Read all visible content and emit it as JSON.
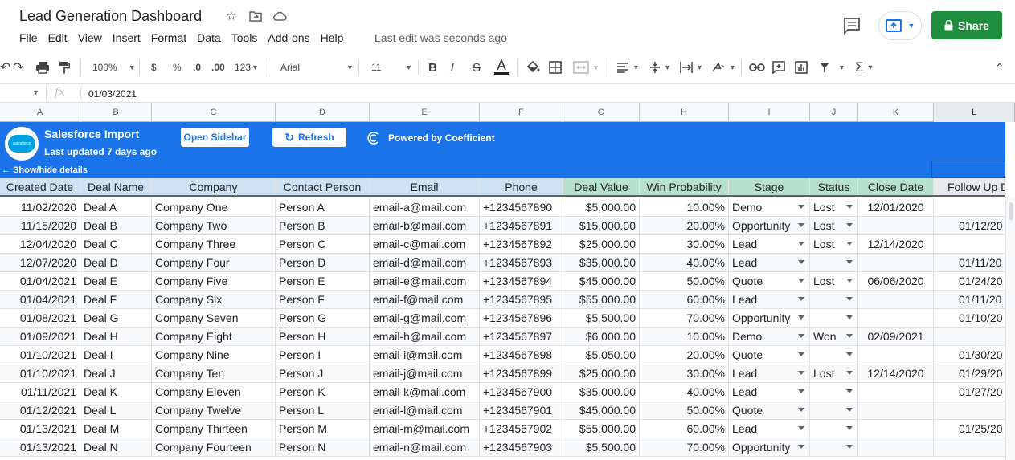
{
  "app": {
    "title": "Lead Generation Dashboard",
    "menu": [
      "File",
      "Edit",
      "View",
      "Insert",
      "Format",
      "Data",
      "Tools",
      "Add-ons",
      "Help"
    ],
    "last_edit": "Last edit was seconds ago",
    "share_label": "Share",
    "accent_green": "#1e8e3e"
  },
  "toolbar": {
    "zoom": "100%",
    "currency": "$",
    "percent": "%",
    "dec_less": ".0",
    "dec_more": ".00",
    "format_more": "123",
    "font": "Arial",
    "font_size": "11"
  },
  "formula_bar": {
    "fx": "fx",
    "value": "01/03/2021"
  },
  "column_letters": [
    "A",
    "B",
    "C",
    "D",
    "E",
    "F",
    "G",
    "H",
    "I",
    "J",
    "K",
    "L"
  ],
  "banner": {
    "title": "Salesforce Import",
    "updated": "Last updated 7 days ago",
    "open_sidebar": "Open Sidebar",
    "refresh": "Refresh",
    "powered": "Powered by Coefficient",
    "toggle": "← Show/hide details",
    "logo_text": "salesforce",
    "color": "#1a73e8"
  },
  "table": {
    "headers": [
      "Created Date",
      "Deal Name",
      "Company",
      "Contact Person",
      "Email",
      "Phone",
      "Deal Value",
      "Win Probability",
      "Stage",
      "Status",
      "Close Date",
      "Follow Up D"
    ],
    "rows": [
      [
        "11/02/2020",
        "Deal A",
        "Company One",
        "Person A",
        "email-a@mail.com",
        "+1234567890",
        "$5,000.00",
        "10.00%",
        "Demo",
        "Lost",
        "12/01/2020",
        ""
      ],
      [
        "11/15/2020",
        "Deal B",
        "Company Two",
        "Person B",
        "email-b@mail.com",
        "+1234567891",
        "$15,000.00",
        "20.00%",
        "Opportunity",
        "Lost",
        "",
        "01/12/20"
      ],
      [
        "12/04/2020",
        "Deal C",
        "Company Three",
        "Person C",
        "email-c@mail.com",
        "+1234567892",
        "$25,000.00",
        "30.00%",
        "Lead",
        "Lost",
        "12/14/2020",
        ""
      ],
      [
        "12/07/2020",
        "Deal D",
        "Company Four",
        "Person D",
        "email-d@mail.com",
        "+1234567893",
        "$35,000.00",
        "40.00%",
        "Lead",
        "",
        "",
        "01/11/20"
      ],
      [
        "01/04/2021",
        "Deal E",
        "Company Five",
        "Person E",
        "email-e@mail.com",
        "+1234567894",
        "$45,000.00",
        "50.00%",
        "Quote",
        "Lost",
        "06/06/2020",
        "01/24/20"
      ],
      [
        "01/04/2021",
        "Deal F",
        "Company Six",
        "Person F",
        "email-f@mail.com",
        "+1234567895",
        "$55,000.00",
        "60.00%",
        "Lead",
        "",
        "",
        "01/11/20"
      ],
      [
        "01/08/2021",
        "Deal G",
        "Company Seven",
        "Person G",
        "email-g@mail.com",
        "+1234567896",
        "$5,500.00",
        "70.00%",
        "Opportunity",
        "",
        "",
        "01/10/20"
      ],
      [
        "01/09/2021",
        "Deal H",
        "Company Eight",
        "Person H",
        "email-h@mail.com",
        "+1234567897",
        "$6,000.00",
        "10.00%",
        "Demo",
        "Won",
        "02/09/2021",
        ""
      ],
      [
        "01/10/2021",
        "Deal I",
        "Company Nine",
        "Person I",
        "email-i@mail.com",
        "+1234567898",
        "$5,050.00",
        "20.00%",
        "Quote",
        "",
        "",
        "01/30/20"
      ],
      [
        "01/10/2021",
        "Deal J",
        "Company Ten",
        "Person J",
        "email-j@mail.com",
        "+1234567899",
        "$25,000.00",
        "30.00%",
        "Lead",
        "Lost",
        "12/14/2020",
        "01/29/20"
      ],
      [
        "01/11/2021",
        "Deal K",
        "Company Eleven",
        "Person K",
        "email-k@mail.com",
        "+1234567900",
        "$35,000.00",
        "40.00%",
        "Lead",
        "",
        "",
        "01/27/20"
      ],
      [
        "01/12/2021",
        "Deal L",
        "Company Twelve",
        "Person L",
        "email-l@mail.com",
        "+1234567901",
        "$45,000.00",
        "50.00%",
        "Quote",
        "",
        "",
        ""
      ],
      [
        "01/13/2021",
        "Deal M",
        "Company Thirteen",
        "Person M",
        "email-m@mail.com",
        "+1234567902",
        "$55,000.00",
        "60.00%",
        "Lead",
        "",
        "",
        "01/25/20"
      ],
      [
        "01/13/2021",
        "Deal N",
        "Company Fourteen",
        "Person N",
        "email-n@mail.com",
        "+1234567903",
        "$5,500.00",
        "70.00%",
        "Opportunity",
        "",
        "",
        ""
      ]
    ]
  },
  "colors": {
    "header_blue": "#cfe2f3",
    "header_green": "#b7e1cd",
    "header_gray": "#e8eaed",
    "row_alt": "#f8f9fa"
  }
}
